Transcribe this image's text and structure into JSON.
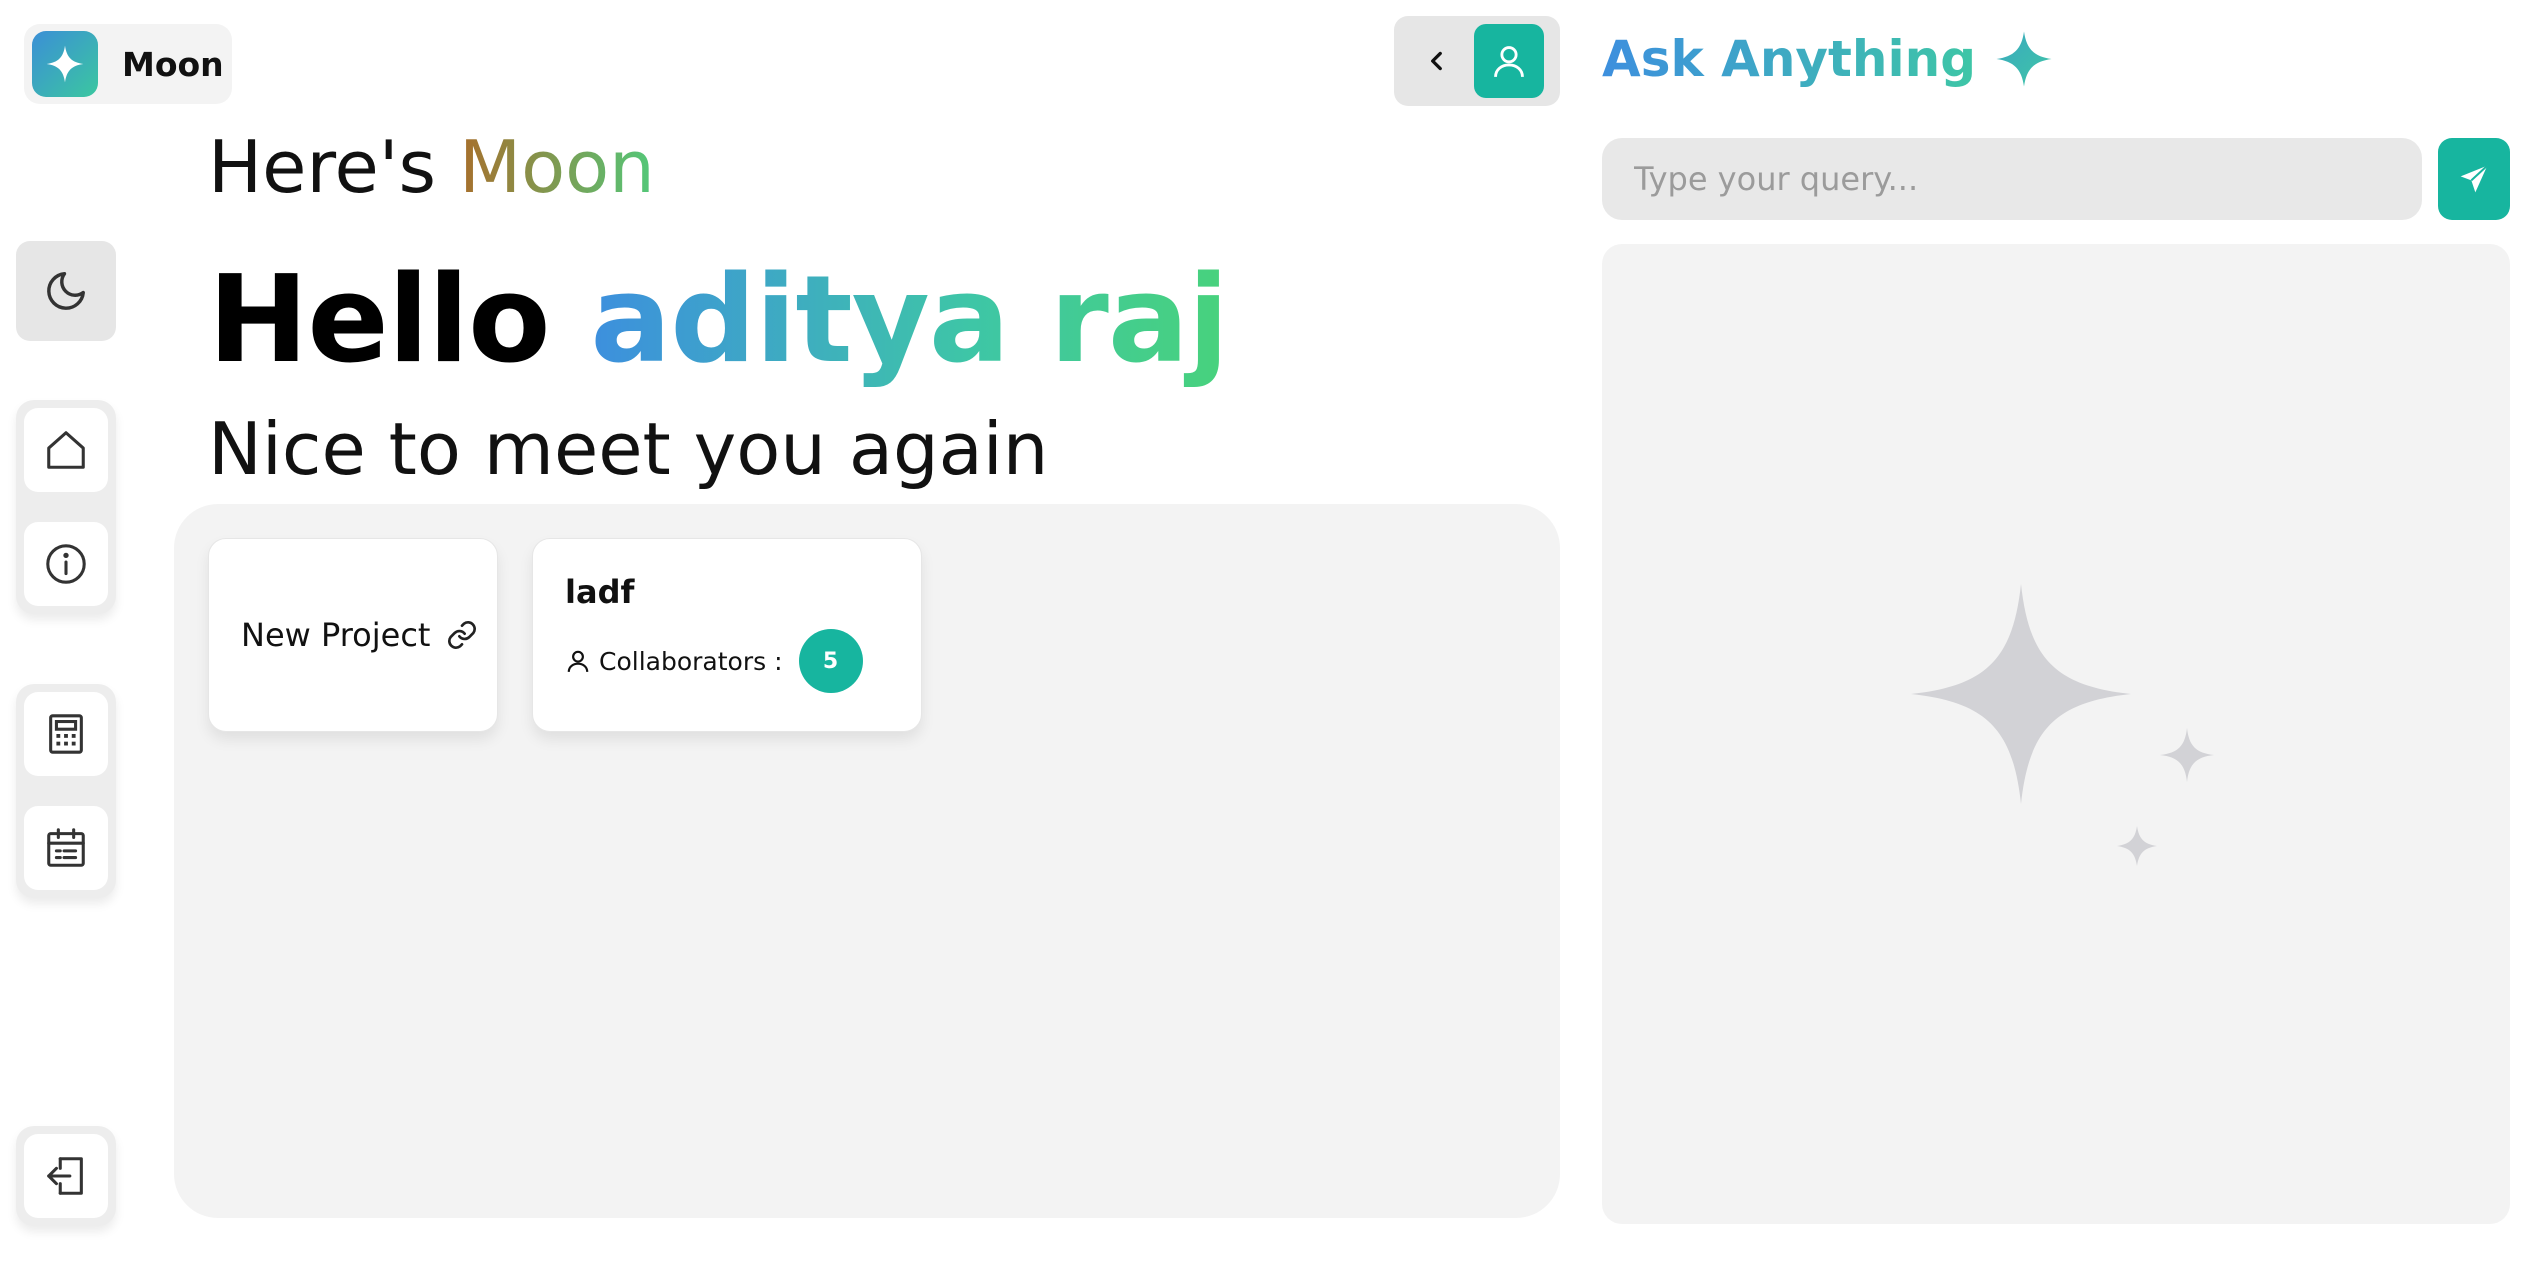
{
  "app": {
    "name": "Moon"
  },
  "header": {
    "intro_prefix": "Here's ",
    "intro_brand": "Moon",
    "greeting_prefix": "Hello ",
    "user_name": "aditya raj",
    "subtitle": "Nice to meet you again"
  },
  "projects": {
    "new_project_label": "New Project",
    "items": [
      {
        "title": "ladf",
        "collaborators_label": "Collaborators :",
        "collaborators_count": "5"
      }
    ]
  },
  "ask": {
    "title": "Ask Anything",
    "placeholder": "Type your query..."
  },
  "sidebar": {
    "items": [
      {
        "icon": "moon-icon"
      },
      {
        "icon": "home-icon"
      },
      {
        "icon": "info-icon"
      },
      {
        "icon": "calculator-icon"
      },
      {
        "icon": "calendar-icon"
      },
      {
        "icon": "logout-icon"
      }
    ]
  },
  "colors": {
    "accent": "#17b59f",
    "gradient_start": "#3d8fde",
    "gradient_end": "#48d27c",
    "panel_bg": "#f3f3f3"
  }
}
